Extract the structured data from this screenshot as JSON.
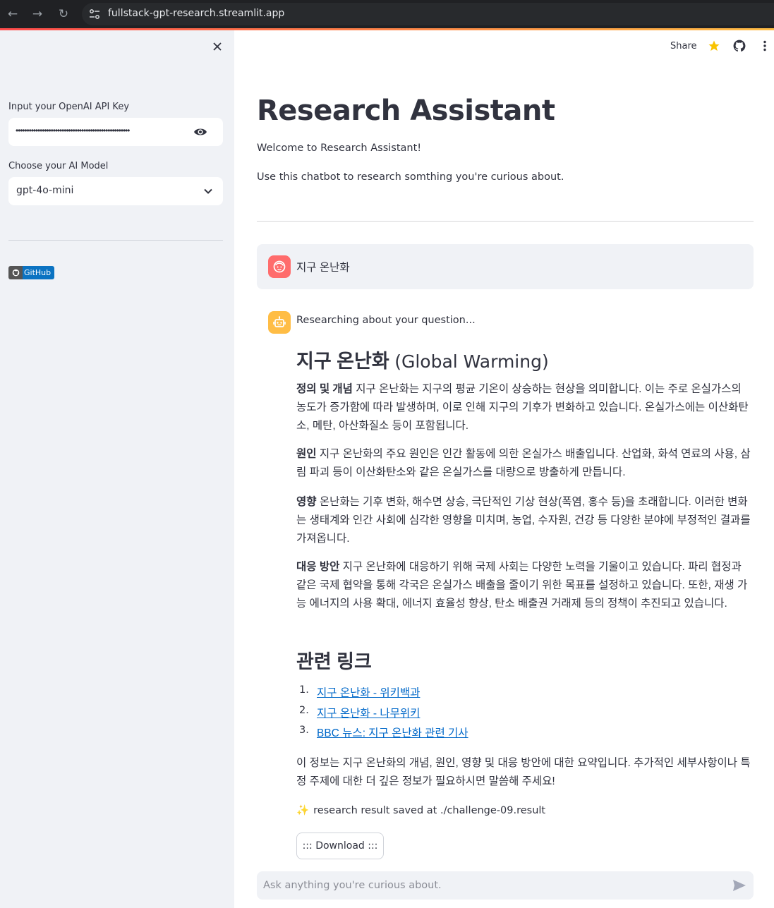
{
  "browser": {
    "url": "fullstack-gpt-research.streamlit.app"
  },
  "sidebar": {
    "api_key_label": "Input your OpenAI API Key",
    "api_key_masked": "••••••••••••••••••••••••••••••••••••••••••••••••••••",
    "model_label": "Choose your AI Model",
    "model_value": "gpt-4o-mini",
    "github_badge": "GitHub"
  },
  "header": {
    "share": "Share"
  },
  "main": {
    "title": "Research Assistant",
    "welcome": "Welcome to Research Assistant!",
    "intro": "Use this chatbot to research somthing you're curious about."
  },
  "chat": {
    "user_message": "지구 온난화",
    "status": "Researching about your question...",
    "heading_ko": "지구 온난화",
    "heading_en": "(Global Warming)",
    "sections": [
      {
        "label": "정의 및 개념",
        "text": " 지구 온난화는 지구의 평균 기온이 상승하는 현상을 의미합니다. 이는 주로 온실가스의 농도가 증가함에 따라 발생하며, 이로 인해 지구의 기후가 변화하고 있습니다. 온실가스에는 이산화탄소, 메탄, 아산화질소 등이 포함됩니다."
      },
      {
        "label": "원인",
        "text": " 지구 온난화의 주요 원인은 인간 활동에 의한 온실가스 배출입니다. 산업화, 화석 연료의 사용, 삼림 파괴 등이 이산화탄소와 같은 온실가스를 대량으로 방출하게 만듭니다."
      },
      {
        "label": "영향",
        "text": " 온난화는 기후 변화, 해수면 상승, 극단적인 기상 현상(폭염, 홍수 등)을 초래합니다. 이러한 변화는 생태계와 인간 사회에 심각한 영향을 미치며, 농업, 수자원, 건강 등 다양한 분야에 부정적인 결과를 가져옵니다."
      },
      {
        "label": "대응 방안",
        "text": " 지구 온난화에 대응하기 위해 국제 사회는 다양한 노력을 기울이고 있습니다. 파리 협정과 같은 국제 협약을 통해 각국은 온실가스 배출을 줄이기 위한 목표를 설정하고 있습니다. 또한, 재생 가능 에너지의 사용 확대, 에너지 효율성 향상, 탄소 배출권 거래제 등의 정책이 추진되고 있습니다."
      }
    ],
    "links_heading": "관련 링크",
    "links": [
      {
        "num": "1.",
        "text": "지구 온난화 - 위키백과"
      },
      {
        "num": "2.",
        "text": "지구 온난화 - 나무위키"
      },
      {
        "num": "3.",
        "text": "BBC 뉴스: 지구 온난화 관련 기사"
      }
    ],
    "summary": "이 정보는 지구 온난화의 개념, 원인, 영향 및 대응 방안에 대한 요약입니다. 추가적인 세부사항이나 특정 주제에 대한 더 깊은 정보가 필요하시면 말씀해 주세요!",
    "saved_icon": "✨",
    "saved_text": "research result saved at ./challenge-09.result",
    "download_label": "::: Download :::",
    "input_placeholder": "Ask anything you're curious about."
  },
  "colors": {
    "sidebar_bg": "#f0f2f6",
    "user_avatar": "#ff6c6c",
    "assistant_avatar": "#ffbd45",
    "link": "#0068c9",
    "star": "#f9c300"
  }
}
